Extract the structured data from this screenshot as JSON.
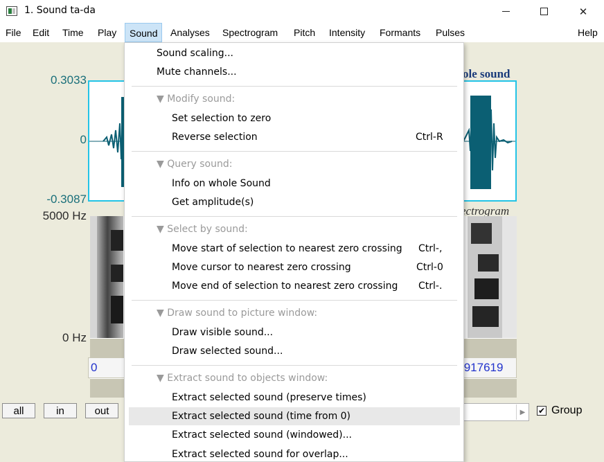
{
  "window": {
    "title": "1. Sound ta-da",
    "minimize_icon": "minimize-icon",
    "maximize_icon": "maximize-icon",
    "close_icon": "close-icon"
  },
  "menubar": {
    "items": [
      "File",
      "Edit",
      "Time",
      "Play",
      "Sound",
      "Analyses",
      "Spectrogram",
      "Pitch",
      "Intensity",
      "Formants",
      "Pulses",
      "Help"
    ],
    "active": "Sound"
  },
  "editor": {
    "y_top": "0.3033",
    "y_zero": "0",
    "y_bottom": "-0.3087",
    "freq_top": "5000 Hz",
    "freq_bottom": "0 Hz",
    "time_start": "0",
    "time_end_visible": ".917619",
    "wave_title_fragment": "ole sound",
    "spectrogram_title_fragment": "ectrogram",
    "wave_color": "#0b5f73",
    "selection_color": "#22c3e6"
  },
  "bottom": {
    "all_label": "all",
    "in_label": "in",
    "out_label": "out",
    "group_label": "Group",
    "group_checked": true,
    "check_glyph": "✔",
    "scroll_arrow_glyph": "▶"
  },
  "dropdown": {
    "items": [
      {
        "label": "Sound scaling...",
        "shortcut": "",
        "type": "item",
        "indent": false
      },
      {
        "label": "Mute channels...",
        "shortcut": "",
        "type": "item",
        "indent": false
      },
      {
        "label": "▼ Modify sound:",
        "shortcut": "",
        "type": "header"
      },
      {
        "label": "Set selection to zero",
        "shortcut": "",
        "type": "item",
        "indent": true
      },
      {
        "label": "Reverse selection",
        "shortcut": "Ctrl-R",
        "type": "item",
        "indent": true
      },
      {
        "label": "▼ Query sound:",
        "shortcut": "",
        "type": "header"
      },
      {
        "label": "Info on whole Sound",
        "shortcut": "",
        "type": "item",
        "indent": true
      },
      {
        "label": "Get amplitude(s)",
        "shortcut": "",
        "type": "item",
        "indent": true
      },
      {
        "label": "▼ Select by sound:",
        "shortcut": "",
        "type": "header"
      },
      {
        "label": "Move start of selection to nearest zero crossing",
        "shortcut": "Ctrl-,",
        "type": "item",
        "indent": true
      },
      {
        "label": "Move cursor to nearest zero crossing",
        "shortcut": "Ctrl-0",
        "type": "item",
        "indent": true
      },
      {
        "label": "Move end of selection to nearest zero crossing",
        "shortcut": "Ctrl-.",
        "type": "item",
        "indent": true
      },
      {
        "label": "▼ Draw sound to picture window:",
        "shortcut": "",
        "type": "header"
      },
      {
        "label": "Draw visible sound...",
        "shortcut": "",
        "type": "item",
        "indent": true
      },
      {
        "label": "Draw selected sound...",
        "shortcut": "",
        "type": "item",
        "indent": true
      },
      {
        "label": "▼ Extract sound to objects window:",
        "shortcut": "",
        "type": "header"
      },
      {
        "label": "Extract selected sound (preserve times)",
        "shortcut": "",
        "type": "item",
        "indent": true
      },
      {
        "label": "Extract selected sound (time from 0)",
        "shortcut": "",
        "type": "item",
        "indent": true,
        "hover": true
      },
      {
        "label": "Extract selected sound (windowed)...",
        "shortcut": "",
        "type": "item",
        "indent": true
      },
      {
        "label": "Extract selected sound for overlap...",
        "shortcut": "",
        "type": "item",
        "indent": true
      }
    ]
  }
}
